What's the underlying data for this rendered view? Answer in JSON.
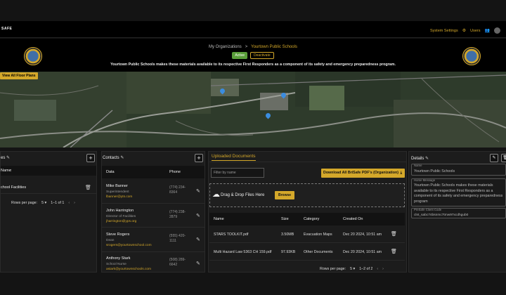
{
  "app": {
    "brand": "SAFE",
    "settings_label": "System Settings",
    "users_label": "Users"
  },
  "breadcrumb": {
    "root": "My Organizations",
    "separator": ">",
    "current": "Yourtown Public Schools"
  },
  "status": {
    "active": "Active",
    "deactivate": "Deactivate"
  },
  "disclaimer": "Yourtown Public Schools makes these materials available to its respective First Responders as a component of its safety and emergency preparedness program.",
  "map": {
    "view_floor_plans": "View All Floor Plans"
  },
  "facilities": {
    "title": "es",
    "col_name": "Name",
    "rows": [
      {
        "name": "chool Facilities"
      }
    ],
    "rows_per_page_label": "Rows per page:",
    "rows_per_page_value": "5",
    "range": "1–1 of 1"
  },
  "contacts": {
    "title": "Contacts",
    "col_data": "Data",
    "col_phone": "Phone",
    "rows": [
      {
        "name": "Mike Banner",
        "role": "Superintendent",
        "email": "lbanner@yts.com",
        "phone1": "(774) 234-",
        "phone2": "8364"
      },
      {
        "name": "John Harrington",
        "role": "Director of Facilities",
        "email": "jharrington@yps.org",
        "phone1": "(774) 238-",
        "phone2": "2879"
      },
      {
        "name": "Steve Rogers",
        "role": "Dean",
        "email": "srogers@yourtownschool.com",
        "phone1": "(555) 420-",
        "phone2": "1111"
      },
      {
        "name": "Anthony Stark",
        "role": "School Nurse",
        "email": "astark@yourtownschools.com",
        "phone1": "(508) 289-",
        "phone2": "6642"
      }
    ]
  },
  "documents": {
    "tab_label": "Uploaded Documents",
    "filter_placeholder": "Filter by name",
    "download_all": "Download All BriSafe PDF's (Organization)",
    "drop_text": "Drag & Drop Files Here",
    "browse": "Browse",
    "col_name": "Name",
    "col_size": "Size",
    "col_category": "Category",
    "col_created": "Created On",
    "rows": [
      {
        "name": "STARS TOOLKIT.pdf",
        "size": "3.50MB",
        "category": "Evacuation Maps",
        "created": "Dec 20 2024, 10:51 am"
      },
      {
        "name": "Multi Hazard Law 5363 CH 159.pdf",
        "size": "97.93KB",
        "category": "Other Documents",
        "created": "Dec 20 2024, 10:51 am"
      }
    ],
    "rows_per_page_label": "Rows per page:",
    "rows_per_page_value": "5",
    "range": "1–2 of 2"
  },
  "details": {
    "title": "Details",
    "name_label": "Name",
    "name_value": "Yourtown Public Schools",
    "home_label": "Home Message",
    "home_value": "Yourtown Public Schools makes these materials available to its respective First Responders as a component of its safety and emergency preparedness program",
    "client_label": "PreSafe Client Code",
    "client_value": "clnt_sabc74bsnmc7tmw97xcdhgub0"
  },
  "icons": {
    "edit": "pencil-icon",
    "add": "plus-icon",
    "delete": "trash-icon",
    "upload": "cloud-upload-icon",
    "download": "download-icon",
    "settings": "gear-icon",
    "users": "users-icon"
  }
}
